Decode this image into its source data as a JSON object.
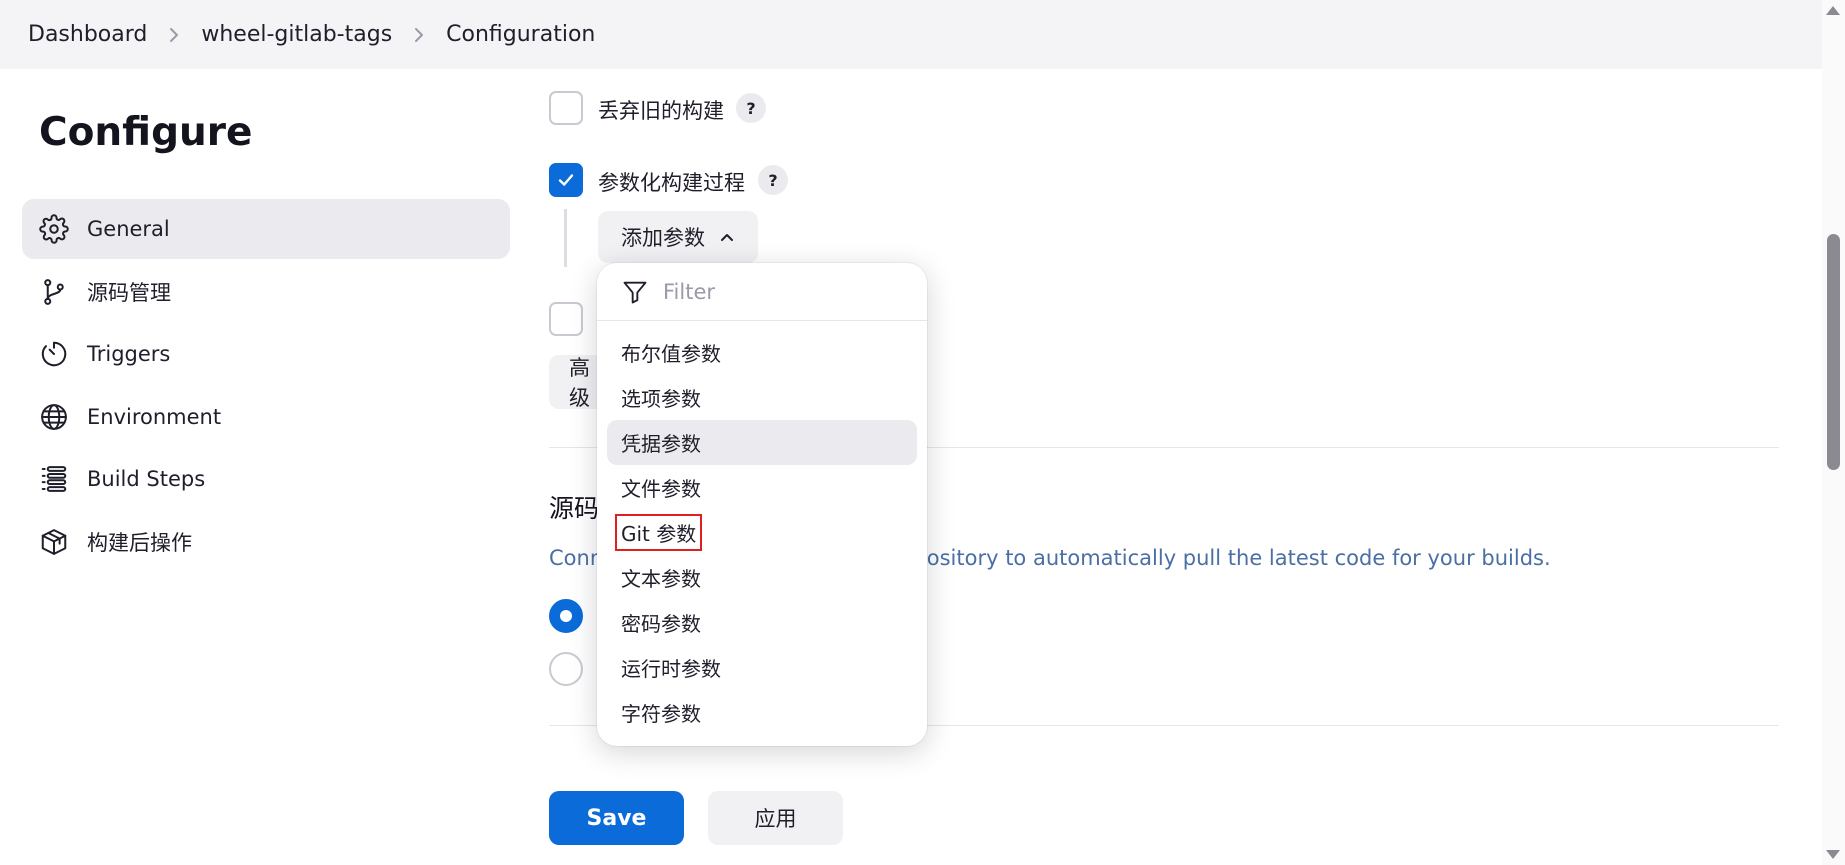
{
  "breadcrumb": {
    "items": [
      "Dashboard",
      "wheel-gitlab-tags",
      "Configuration"
    ]
  },
  "sidebar": {
    "title": "Configure",
    "items": [
      {
        "label": "General",
        "icon": "gear-icon",
        "active": true
      },
      {
        "label": "源码管理",
        "icon": "git-branch-icon"
      },
      {
        "label": "Triggers",
        "icon": "timer-icon"
      },
      {
        "label": "Environment",
        "icon": "globe-icon"
      },
      {
        "label": "Build Steps",
        "icon": "list-icon"
      },
      {
        "label": "构建后操作",
        "icon": "package-icon"
      }
    ]
  },
  "general": {
    "discard_old_builds_label": "丢弃旧的构建",
    "discard_old_builds_checked": false,
    "parameterized_label": "参数化构建过程",
    "parameterized_checked": true,
    "help_label": "?",
    "add_param_label": "添加参数",
    "advanced_label": "高级"
  },
  "dropdown": {
    "filter_placeholder": "Filter",
    "items": [
      "布尔值参数",
      "选项参数",
      "凭据参数",
      "文件参数",
      "Git 参数",
      "文本参数",
      "密码参数",
      "运行时参数",
      "字符参数"
    ],
    "hovered_index": 2,
    "highlighted_index": 4
  },
  "scm": {
    "title": "源码管理",
    "description": "Connect and manage your code repository to automatically pull the latest code for your builds."
  },
  "actions": {
    "save_label": "Save",
    "apply_label": "应用"
  },
  "colors": {
    "accent": "#0b6bd8",
    "highlight_outline": "#e02020",
    "description_text": "#4a6fa5"
  }
}
